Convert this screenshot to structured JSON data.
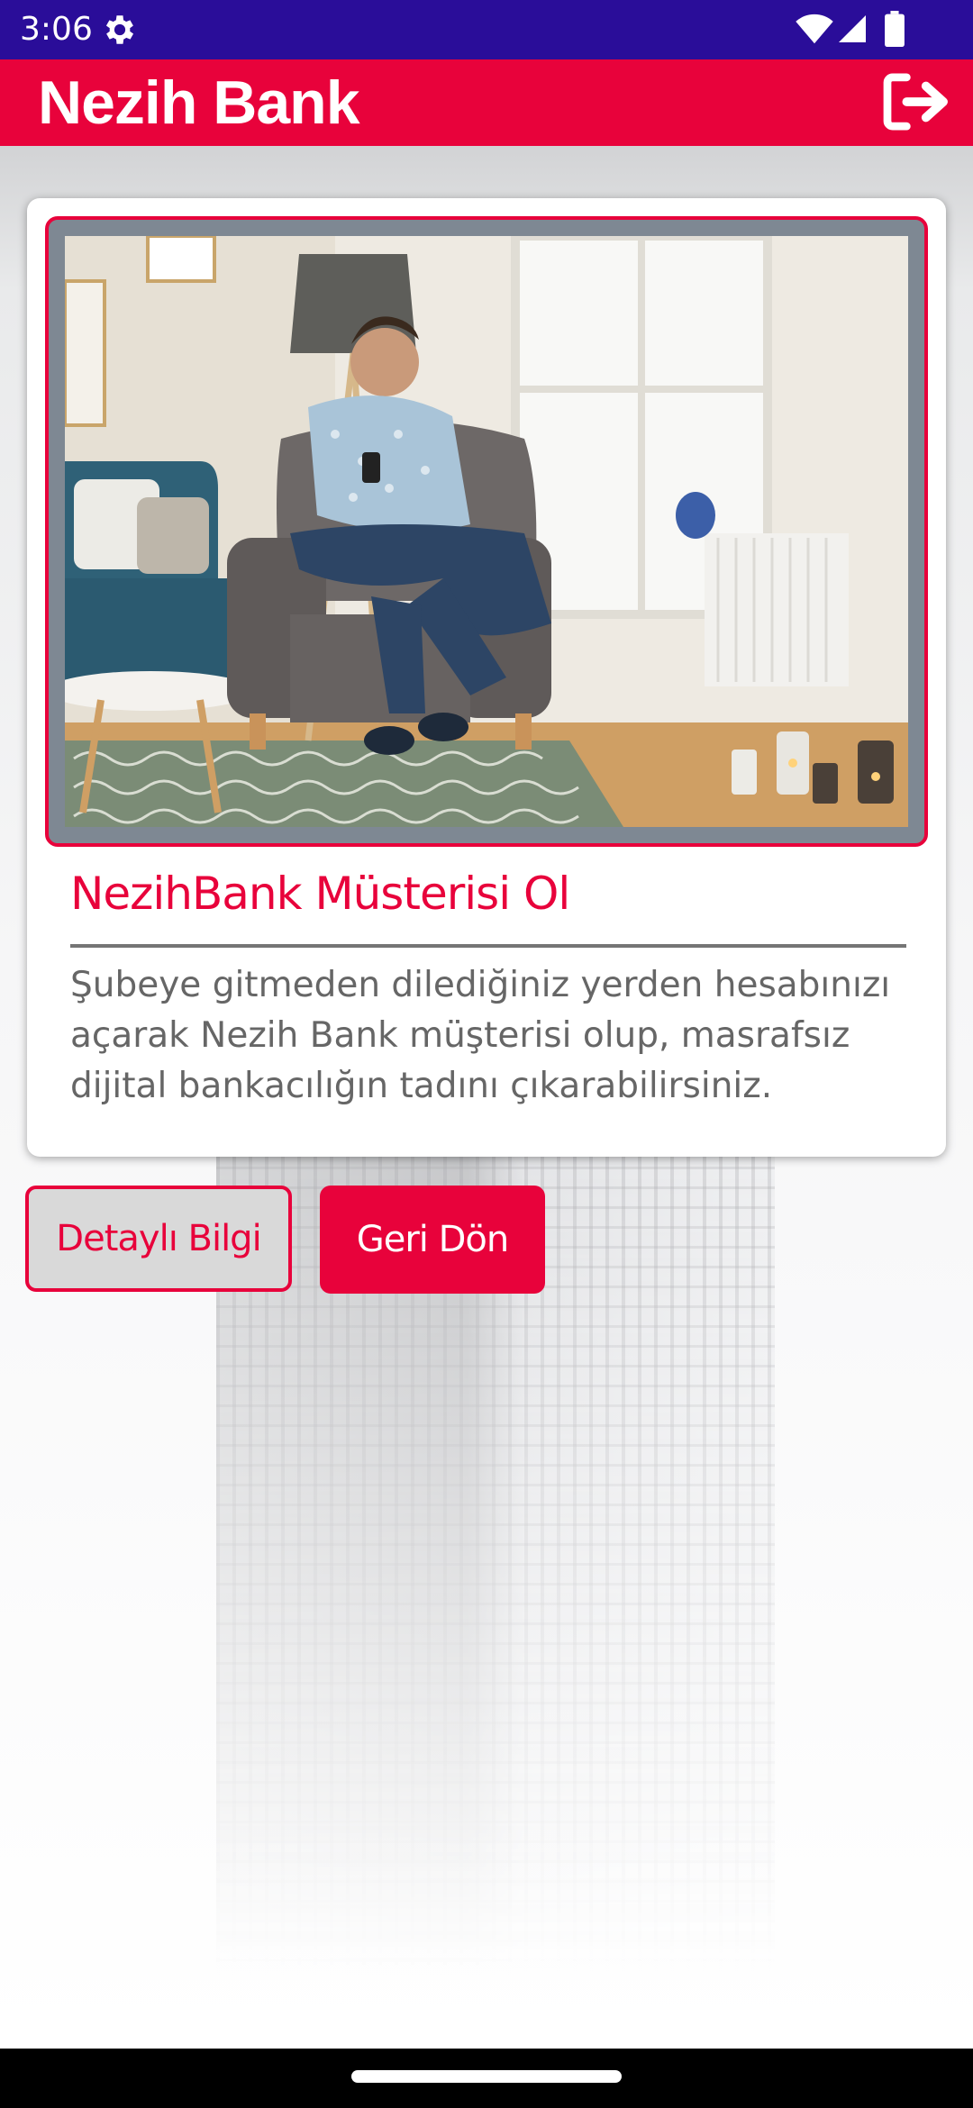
{
  "status_bar": {
    "time": "3:06",
    "icons": [
      "settings-gear-icon",
      "wifi-icon",
      "cell-signal-icon",
      "battery-icon"
    ]
  },
  "app_bar": {
    "title": "Nezih Bank",
    "logout_icon": "logout-icon"
  },
  "card": {
    "image": "man-on-armchair-with-phone-photo",
    "title": "NezihBank Müsterisi Ol",
    "description": "Şubeye gitmeden dilediğiniz yerden hesabınızı açarak Nezih Bank müşterisi olup, masrafsız dijital bankacılığın tadını çıkarabilirsiniz."
  },
  "buttons": {
    "detail_label": "Detaylı Bilgi",
    "back_label": "Geri Dön"
  },
  "colors": {
    "brand_red": "#e8023b",
    "status_bar": "#2a0d99",
    "button_gray": "#d9d9d9",
    "text_gray": "#666666"
  }
}
